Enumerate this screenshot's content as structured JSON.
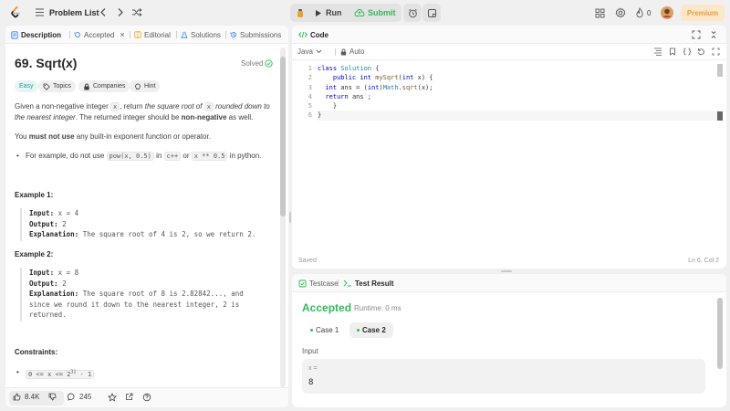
{
  "topnav": {
    "problem_list": "Problem List",
    "run": "Run",
    "submit": "Submit",
    "streak_count": "0",
    "premium": "Premium"
  },
  "left_tabs": [
    {
      "label": "Description"
    },
    {
      "label": "Accepted"
    },
    {
      "label": "Editorial"
    },
    {
      "label": "Solutions"
    },
    {
      "label": "Submissions"
    }
  ],
  "problem": {
    "title": "69. Sqrt(x)",
    "status": "Solved",
    "chips": {
      "easy": "Easy",
      "topics": "Topics",
      "companies": "Companies",
      "hint": "Hint"
    },
    "p1_a": "Given a non-negative integer ",
    "p1_code1": "x",
    "p1_b": ", return ",
    "p1_i1": "the square root of ",
    "p1_code2": "x",
    "p1_i2": " rounded down to the nearest integer",
    "p1_c": ". The returned integer should be ",
    "p1_bold": "non-negative",
    "p1_d": " as well.",
    "p2_a": "You ",
    "p2_bold": "must not use",
    "p2_b": " any built-in exponent function or operator.",
    "bullet_a": "For example, do not use ",
    "bullet_code1": "pow(x, 0.5)",
    "bullet_b": " in ",
    "bullet_code2": "c++",
    "bullet_c": " or ",
    "bullet_code3": "x ** 0.5",
    "bullet_d": " in python."
  },
  "examples": [
    {
      "title": "Example 1:",
      "input_label": "Input:",
      "input": "x = 4",
      "output_label": "Output:",
      "output": "2",
      "expl_label": "Explanation:",
      "expl": "The square root of 4 is 2, so we return 2."
    },
    {
      "title": "Example 2:",
      "input_label": "Input:",
      "input": "x = 8",
      "output_label": "Output:",
      "output": "2",
      "expl_label": "Explanation:",
      "expl": "The square root of 8 is 2.82842..., and",
      "expl2": "since we round it down to the nearest integer, 2 is",
      "expl3": "returned."
    }
  ],
  "constraints": {
    "title": "Constraints:",
    "c1_a": "0 <= x <= 2",
    "c1_sup": "31",
    "c1_b": " - 1"
  },
  "left_footer": {
    "likes": "8.4K",
    "comments": "245"
  },
  "code_panel": {
    "title": "Code",
    "language": "Java",
    "mode": "Auto",
    "saved": "Saved",
    "cursor": "Ln 6, Col 2",
    "line_numbers": [
      "1",
      "2",
      "3",
      "4",
      "5",
      "6"
    ]
  },
  "result_panel": {
    "tab_testcase": "Testcase",
    "tab_result": "Test Result",
    "verdict": "Accepted",
    "runtime": "Runtime: 0 ms",
    "case1": "Case 1",
    "case2": "Case 2",
    "input_heading": "Input",
    "var_label": "x =",
    "var_value": "8"
  }
}
